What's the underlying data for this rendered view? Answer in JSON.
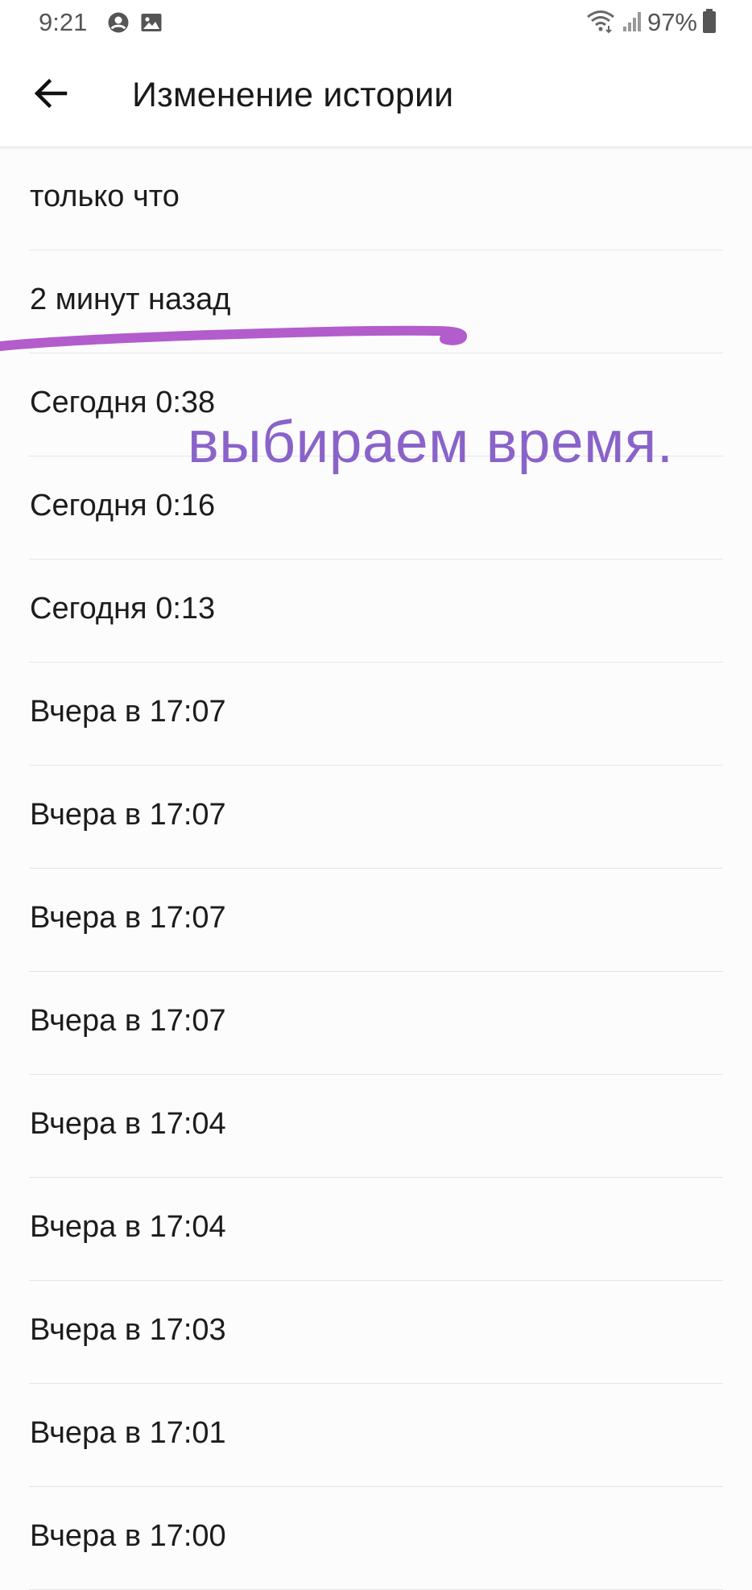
{
  "status_bar": {
    "time": "9:21",
    "battery": "97%",
    "icons": [
      "account-circle-icon",
      "image-icon",
      "wifi-icon",
      "signal-icon",
      "battery-icon"
    ]
  },
  "app_bar": {
    "title": "Изменение истории",
    "back_icon": "arrow-left-icon"
  },
  "history": {
    "items": [
      {
        "label": "только что"
      },
      {
        "label": "2 минут назад"
      },
      {
        "label": "Сегодня 0:38"
      },
      {
        "label": "Сегодня 0:16"
      },
      {
        "label": "Сегодня 0:13"
      },
      {
        "label": "Вчера в 17:07"
      },
      {
        "label": "Вчера в 17:07"
      },
      {
        "label": "Вчера в 17:07"
      },
      {
        "label": "Вчера в 17:07"
      },
      {
        "label": "Вчера в 17:04"
      },
      {
        "label": "Вчера в 17:04"
      },
      {
        "label": "Вчера в 17:03"
      },
      {
        "label": "Вчера в 17:01"
      },
      {
        "label": "Вчера в 17:00"
      }
    ]
  },
  "annotation": {
    "text": "выбираем время.",
    "color": "#8a63c9",
    "stroke_color": "#b35ccc"
  }
}
